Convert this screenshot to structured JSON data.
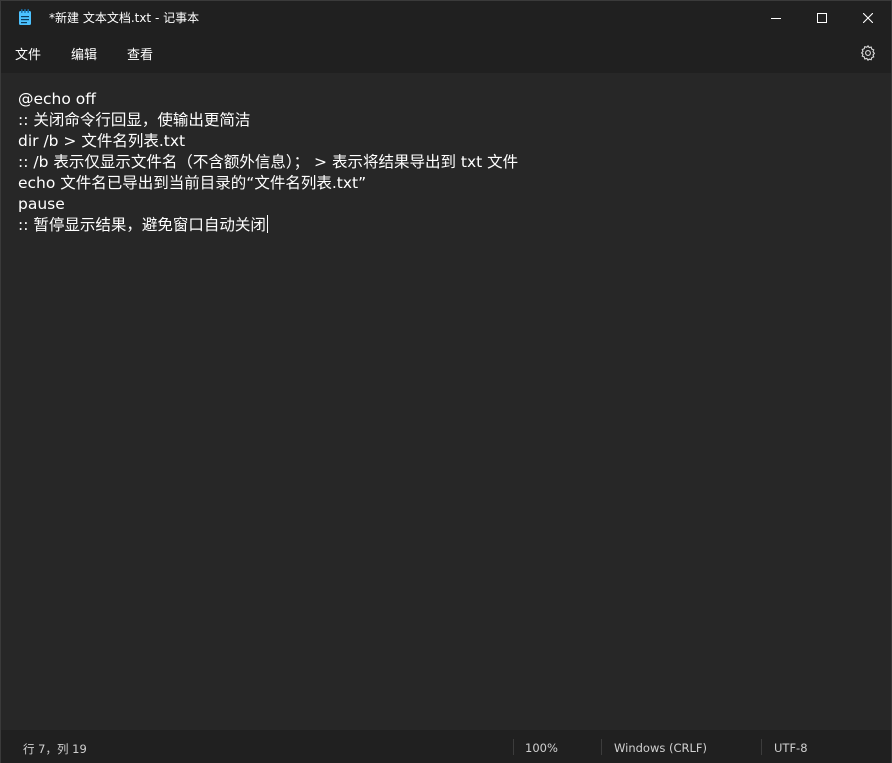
{
  "window": {
    "title": "*新建 文本文档.txt - 记事本",
    "controls": {
      "minimize_icon": "minimize-icon",
      "maximize_icon": "maximize-icon",
      "close_icon": "close-icon"
    }
  },
  "menu": {
    "items": [
      {
        "label": "文件"
      },
      {
        "label": "编辑"
      },
      {
        "label": "查看"
      }
    ],
    "settings_icon": "gear-icon"
  },
  "editor": {
    "lines": [
      "@echo off",
      ":: 关闭命令行回显，使输出更简洁",
      "dir /b > 文件名列表.txt",
      ":: /b 表示仅显示文件名（不含额外信息）； > 表示将结果导出到 txt 文件",
      "echo 文件名已导出到当前目录的“文件名列表.txt”",
      "pause",
      ":: 暂停显示结果，避免窗口自动关闭"
    ]
  },
  "status": {
    "position": "行 7，列 19",
    "zoom": "100%",
    "line_ending": "Windows (CRLF)",
    "encoding": "UTF-8"
  },
  "colors": {
    "chrome_bg": "#202020",
    "editor_bg": "#272727",
    "text": "#ffffff",
    "icon_accent": "#4cc2ff"
  }
}
